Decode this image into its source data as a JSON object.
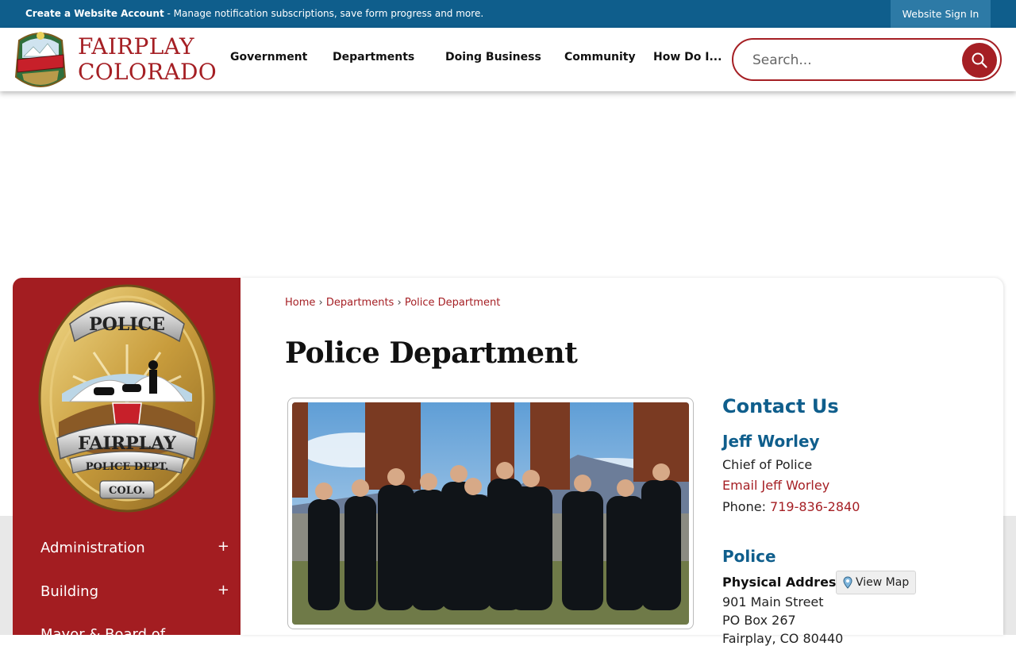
{
  "topbar": {
    "create_account_bold": "Create a Website Account",
    "create_account_rest": " - Manage notification subscriptions, save form progress and more.",
    "sign_in": "Website Sign In"
  },
  "header": {
    "logo_line1": "FAIRPLAY",
    "logo_line2": "COLORADO",
    "nav": [
      "Government",
      "Departments",
      "Doing Business",
      "Community",
      "How Do I..."
    ],
    "search_placeholder": "Search..."
  },
  "sidebar": {
    "badge_top": "POLICE",
    "badge_name": "FAIRPLAY",
    "badge_dept": "POLICE DEPT.",
    "badge_colo": "COLO.",
    "items": [
      {
        "label": "Administration",
        "toggle": "+"
      },
      {
        "label": "Building",
        "toggle": "+"
      },
      {
        "label": "Mayor & Board of"
      }
    ]
  },
  "breadcrumb": {
    "home": "Home",
    "sep": "›",
    "departments": "Departments",
    "current": "Police Department"
  },
  "page_title": "Police Department",
  "contact": {
    "heading": "Contact Us",
    "name": "Jeff Worley",
    "role": "Chief of Police",
    "email_link": "Email Jeff Worley",
    "phone_label": "Phone: ",
    "phone": "719-836-2840",
    "section": "Police",
    "address_label": "Physical Address",
    "view_map": "View Map",
    "address_lines": [
      "901 Main Street",
      "PO Box 267",
      "Fairplay, CO 80440"
    ]
  },
  "colors": {
    "brand_red": "#a51f24",
    "brand_blue": "#0f5e8c"
  }
}
